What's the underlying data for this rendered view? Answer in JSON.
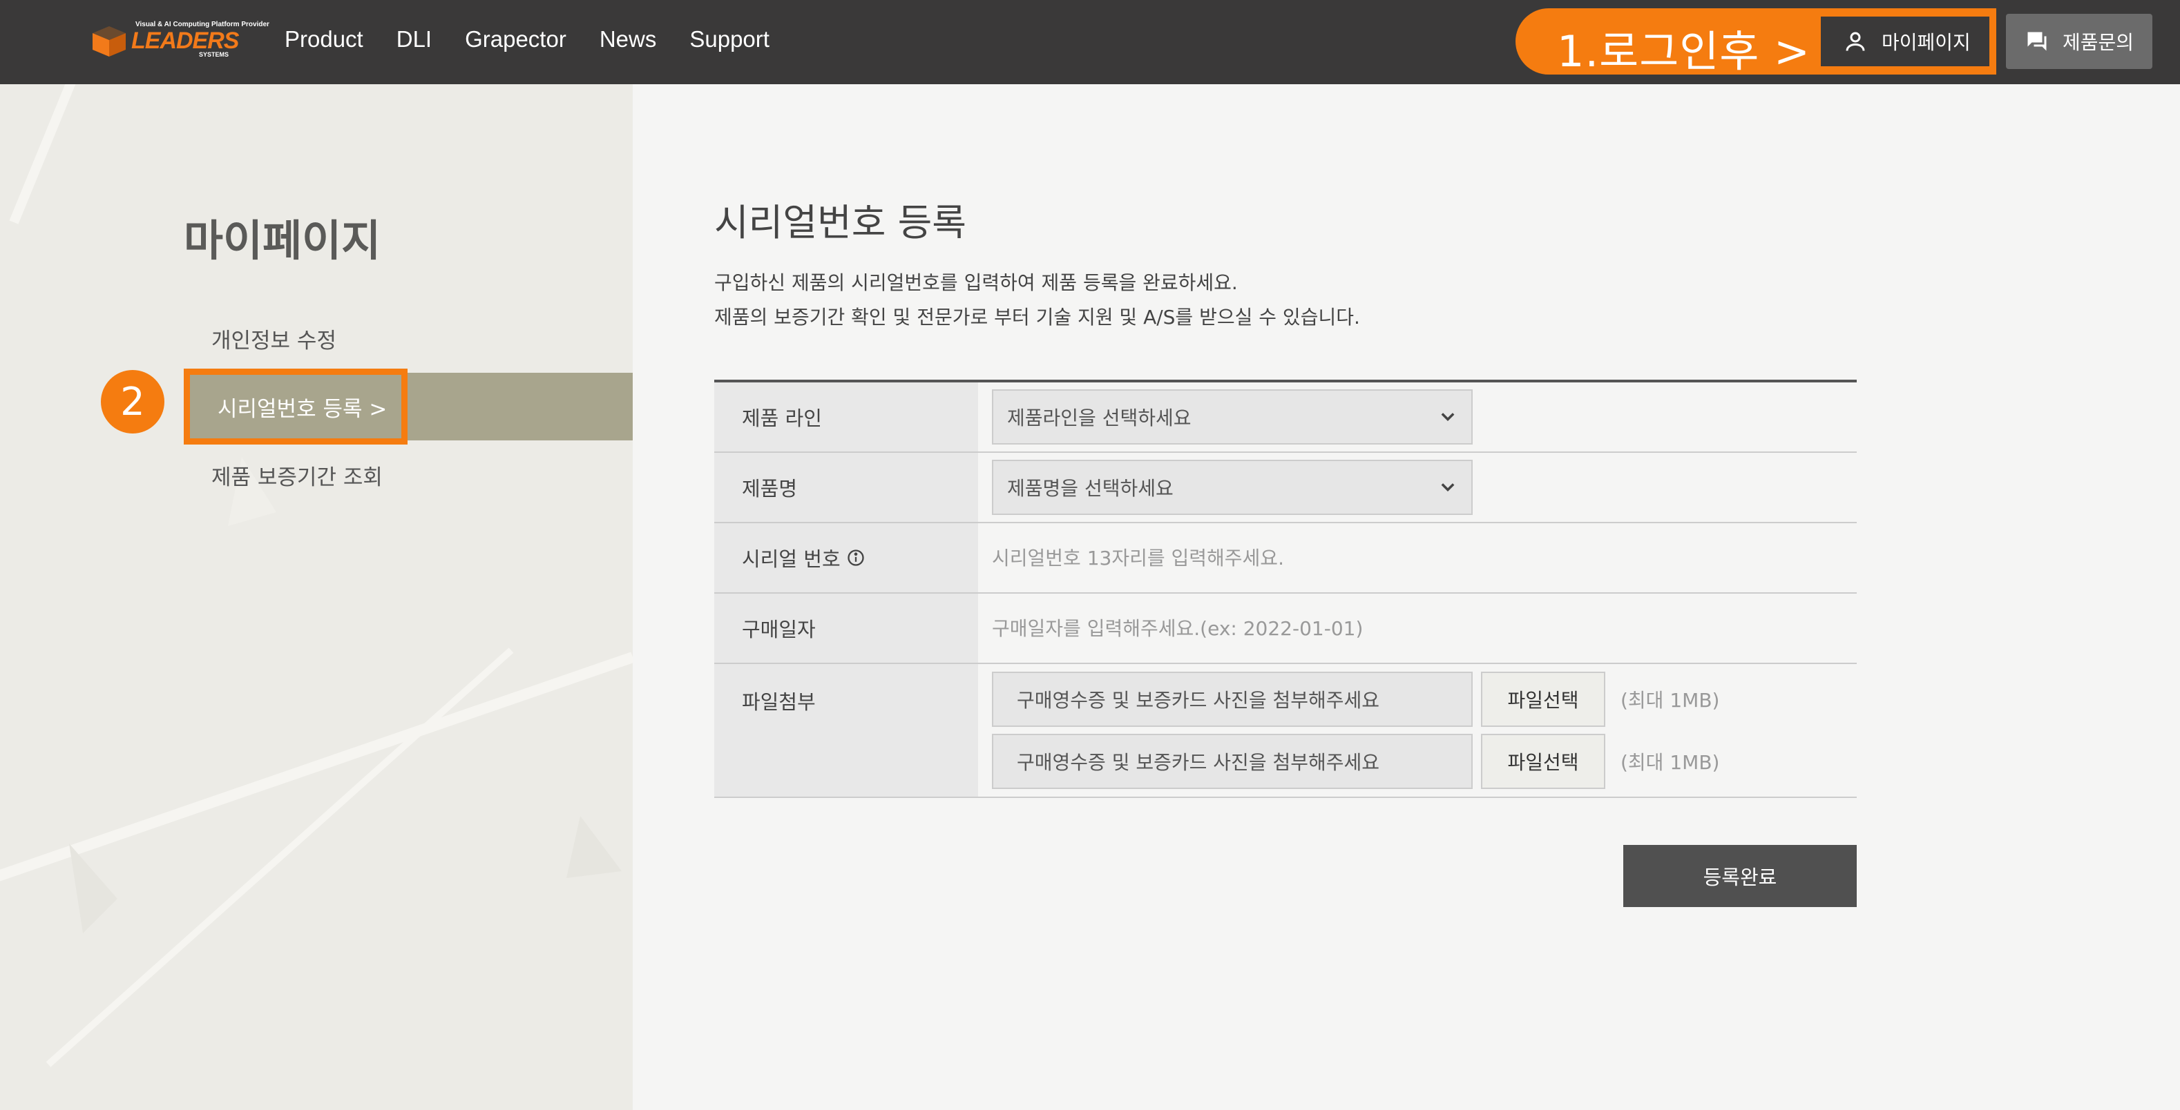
{
  "header": {
    "logo_tagline": "Visual & AI Computing Platform Provider",
    "logo_wordmark": "LEADERS",
    "logo_sub": "SYSTEMS",
    "nav": [
      "Product",
      "DLI",
      "Grapector",
      "News",
      "Support"
    ],
    "annotation": "1.로그인후 >",
    "mypage_label": "마이페이지",
    "inquiry_label": "제품문의"
  },
  "sidebar": {
    "title": "마이페이지",
    "step_badge": "2",
    "items": [
      "개인정보 수정",
      "시리얼번호 등록 >",
      "제품 보증기간 조회"
    ]
  },
  "main": {
    "title": "시리얼번호 등록",
    "desc_line1": "구입하신 제품의 시리얼번호를 입력하여 제품 등록을 완료하세요.",
    "desc_line2": "제품의 보증기간 확인 및 전문가로 부터 기술 지원 및 A/S를 받으실 수 있습니다.",
    "form": {
      "product_line_label": "제품 라인",
      "product_line_value": "제품라인을 선택하세요",
      "product_name_label": "제품명",
      "product_name_value": "제품명을 선택하세요",
      "serial_label": "시리얼 번호",
      "serial_placeholder": "시리얼번호 13자리를 입력해주세요.",
      "purchase_label": "구매일자",
      "purchase_placeholder": "구매일자를 입력해주세요.(ex: 2022-01-01)",
      "file_label": "파일첨부",
      "files": [
        {
          "text": "구매영수증 및 보증카드 사진을 첨부해주세요",
          "button": "파일선택",
          "limit": "(최대 1MB)"
        },
        {
          "text": "구매영수증 및 보증카드 사진을 첨부해주세요",
          "button": "파일선택",
          "limit": "(최대 1MB)"
        }
      ]
    },
    "submit_label": "등록완료"
  },
  "colors": {
    "header_bg": "#3a3939",
    "accent_orange": "#f57c10",
    "sidebar_active": "#a8a58d",
    "submit_bg": "#505050"
  }
}
